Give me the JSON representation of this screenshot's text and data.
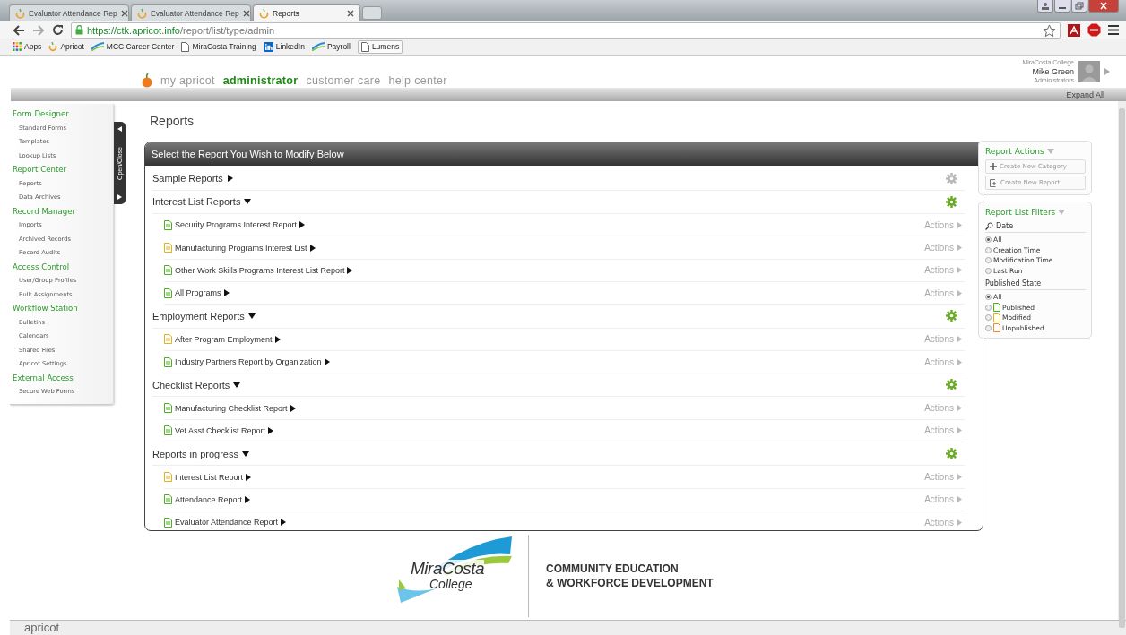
{
  "browser": {
    "tabs": [
      {
        "title": "Evaluator Attendance Rep",
        "selected": false
      },
      {
        "title": "Evaluator Attendance Rep",
        "selected": false
      },
      {
        "title": "Reports",
        "selected": true
      }
    ],
    "url": {
      "scheme": "https://",
      "host": "ctk.apricot.info",
      "path": "/report/list/type/admin"
    },
    "bookmarks": [
      {
        "label": "Apps",
        "kind": "apps"
      },
      {
        "label": "Apricot",
        "kind": "apricot"
      },
      {
        "label": "MCC Career Center",
        "kind": "wave"
      },
      {
        "label": "MiraCosta Training",
        "kind": "page"
      },
      {
        "label": "LinkedIn",
        "kind": "linkedin"
      },
      {
        "label": "Payroll",
        "kind": "wave"
      },
      {
        "label": "Lumens",
        "kind": "page"
      }
    ]
  },
  "header": {
    "nav": [
      {
        "label": "my apricot",
        "selected": false
      },
      {
        "label": "administrator",
        "selected": true
      },
      {
        "label": "customer care",
        "selected": false
      },
      {
        "label": "help center",
        "selected": false
      }
    ],
    "user": {
      "org": "MiraCosta College",
      "name": "Mike Green",
      "role": "Administrators"
    },
    "expand_all": "Expand All"
  },
  "sidebar": {
    "toggle": "Open/Close",
    "sections": [
      {
        "title": "Form Designer",
        "items": [
          "Standard Forms",
          "Templates",
          "Lookup Lists"
        ]
      },
      {
        "title": "Report Center",
        "items": [
          "Reports",
          "Data Archives"
        ]
      },
      {
        "title": "Record Manager",
        "items": [
          "Imports",
          "Archived Records",
          "Record Audits"
        ]
      },
      {
        "title": "Access Control",
        "items": [
          "User/Group Profiles",
          "Bulk Assignments"
        ]
      },
      {
        "title": "Workflow Station",
        "items": [
          "Bulletins",
          "Calendars",
          "Shared Files",
          "Apricot Settings"
        ]
      },
      {
        "title": "External Access",
        "items": [
          "Secure Web Forms"
        ]
      }
    ]
  },
  "page_title": "Reports",
  "panel": {
    "title": "Select the Report You Wish to Modify Below",
    "categories": [
      {
        "name": "Sample Reports",
        "expanded": false,
        "editable": false
      },
      {
        "name": "Interest List Reports",
        "expanded": true,
        "editable": true,
        "reports": [
          {
            "name": "Security Programs Interest Report",
            "kind": "published",
            "actions": "Actions"
          },
          {
            "name": "Manufacturing Programs Interest List",
            "kind": "modified",
            "actions": "Actions"
          },
          {
            "name": "Other Work Skills Programs Interest List Report",
            "kind": "published",
            "actions": "Actions"
          },
          {
            "name": "All Programs",
            "kind": "published",
            "actions": "Actions"
          }
        ]
      },
      {
        "name": "Employment Reports",
        "expanded": true,
        "editable": true,
        "reports": [
          {
            "name": "After Program Employment",
            "kind": "modified",
            "actions": "Actions"
          },
          {
            "name": "Industry Partners Report by Organization",
            "kind": "published",
            "actions": "Actions"
          }
        ]
      },
      {
        "name": "Checklist Reports",
        "expanded": true,
        "editable": true,
        "reports": [
          {
            "name": "Manufacturing Checklist Report",
            "kind": "published",
            "actions": "Actions"
          },
          {
            "name": "Vet Asst Checklist Report",
            "kind": "published",
            "actions": "Actions"
          }
        ]
      },
      {
        "name": "Reports in progress",
        "expanded": true,
        "editable": true,
        "reports": [
          {
            "name": "Interest List Report",
            "kind": "modified",
            "actions": "Actions"
          },
          {
            "name": "Attendance Report",
            "kind": "published",
            "actions": "Actions"
          },
          {
            "name": "Evaluator Attendance Report",
            "kind": "published",
            "actions": "Actions"
          }
        ]
      }
    ]
  },
  "report_actions": {
    "title": "Report Actions",
    "buttons": [
      {
        "label": "Create New Category",
        "kind": "category"
      },
      {
        "label": "Create New Report",
        "kind": "report"
      }
    ]
  },
  "filters": {
    "title": "Report List Filters",
    "date_label": "Date",
    "date_options": [
      {
        "label": "All",
        "selected": true
      },
      {
        "label": "Creation Time",
        "selected": false
      },
      {
        "label": "Modification Time",
        "selected": false
      },
      {
        "label": "Last Run",
        "selected": false
      }
    ],
    "state_label": "Published State",
    "state_options": [
      {
        "label": "All",
        "selected": true,
        "kind": "any"
      },
      {
        "label": "Published",
        "selected": false,
        "kind": "published"
      },
      {
        "label": "Modified",
        "selected": false,
        "kind": "modified"
      },
      {
        "label": "Unpublished",
        "selected": false,
        "kind": "unpublished"
      }
    ]
  },
  "footer": {
    "logo_top": "MiraCosta",
    "logo_bottom": "College",
    "division_line1": "COMMUNITY EDUCATION",
    "division_line2": "& WORKFORCE DEVELOPMENT",
    "brand": "apricot"
  }
}
